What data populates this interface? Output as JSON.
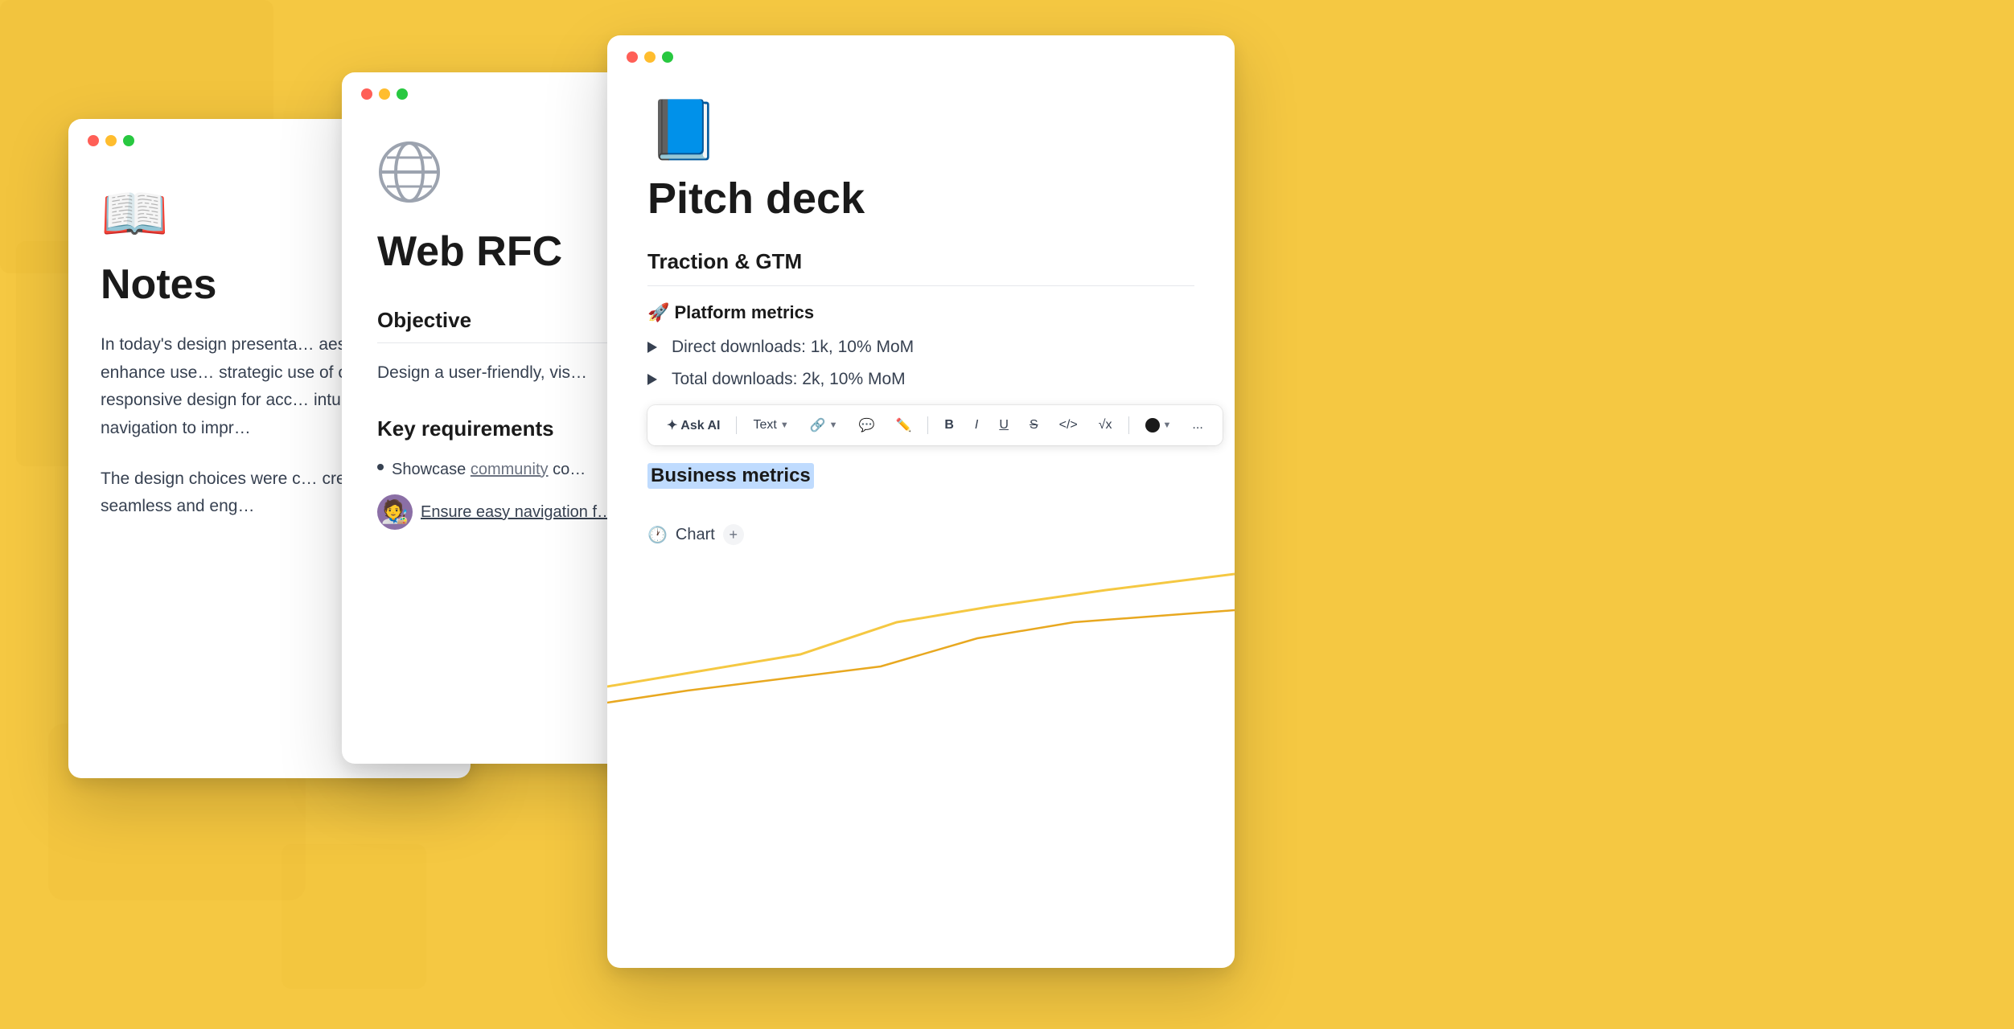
{
  "background": {
    "color": "#F5C842"
  },
  "window_notes": {
    "title": "Notes",
    "icon": "📖",
    "body1": "In today's design presenta… aesthetics to enhance use… strategic use of color and … responsive design for acc… intuitive navigation to impr…",
    "body2": "The design choices were c… create a seamless and eng…",
    "traffic_lights": [
      "red",
      "yellow",
      "green"
    ]
  },
  "window_rfc": {
    "title": "Web RFC",
    "objective_label": "Objective",
    "objective_text": "Design a user-friendly, vis…",
    "key_requirements_label": "Key requirements",
    "item1_prefix": "Showcase ",
    "item1_link": "community",
    "item1_suffix": " co…",
    "item2": "Ensure easy navigation f…",
    "traffic_lights": [
      "red",
      "yellow",
      "green"
    ]
  },
  "window_pitch": {
    "title": "Pitch deck",
    "icon": "📘",
    "section_heading": "Traction & GTM",
    "platform_metrics_label": "🚀 Platform metrics",
    "download_items": [
      "Direct downloads: 1k, 10% MoM",
      "Total downloads: 2k, 10% MoM"
    ],
    "toolbar": {
      "ask_ai_label": "✦ Ask AI",
      "text_label": "Text",
      "link_icon": "🔗",
      "comment_icon": "💬",
      "edit_icon": "✏️",
      "bold_label": "B",
      "italic_label": "I",
      "underline_label": "U",
      "strikethrough_label": "S",
      "code_label": "</>",
      "math_label": "√x",
      "more_label": "..."
    },
    "business_metrics_label": "Business metrics",
    "chart_label": "Chart",
    "chart_add": "+",
    "traffic_lights": [
      "red",
      "yellow",
      "green"
    ]
  }
}
